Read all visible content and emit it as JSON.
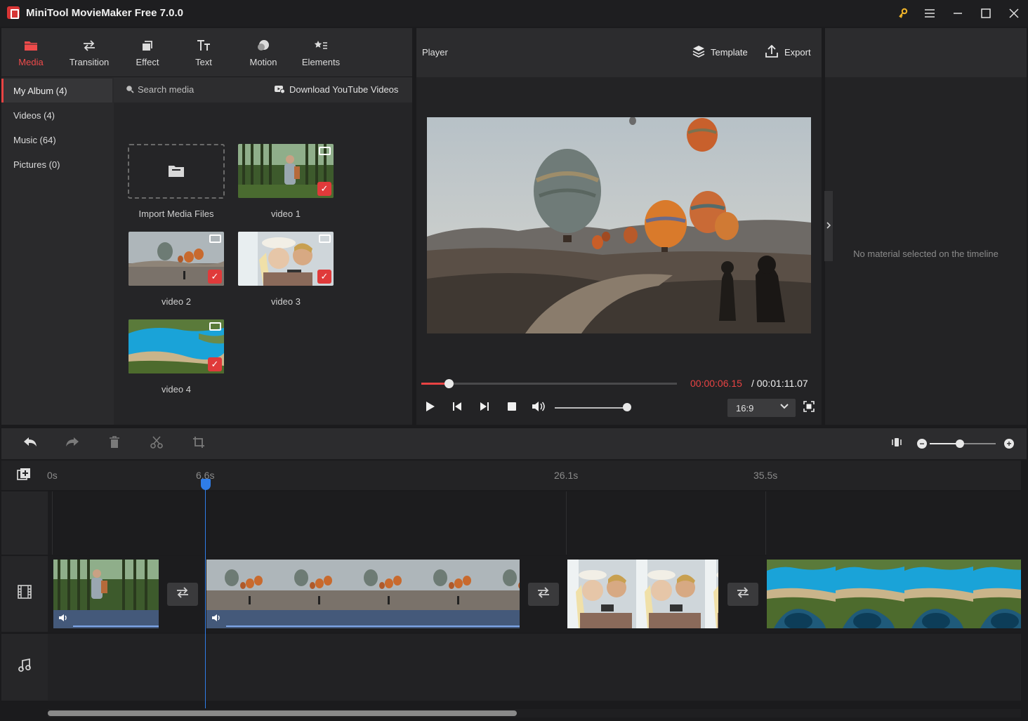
{
  "window": {
    "title": "MiniTool MovieMaker Free 7.0.0"
  },
  "tabs": [
    {
      "label": "Media",
      "icon": "folder-icon",
      "active": true
    },
    {
      "label": "Transition",
      "icon": "transition-icon"
    },
    {
      "label": "Effect",
      "icon": "effect-icon"
    },
    {
      "label": "Text",
      "icon": "text-icon"
    },
    {
      "label": "Motion",
      "icon": "motion-icon"
    },
    {
      "label": "Elements",
      "icon": "elements-icon"
    }
  ],
  "sidebar": {
    "items": [
      {
        "label": "My Album (4)",
        "active": true
      },
      {
        "label": "Videos (4)"
      },
      {
        "label": "Music (64)"
      },
      {
        "label": "Pictures (0)"
      }
    ]
  },
  "media": {
    "search_placeholder": "Search media",
    "download_label": "Download YouTube Videos",
    "import_label": "Import Media Files",
    "items": [
      {
        "label": "video 1"
      },
      {
        "label": "video 2"
      },
      {
        "label": "video 3"
      },
      {
        "label": "video 4"
      }
    ]
  },
  "player": {
    "title": "Player",
    "template_label": "Template",
    "export_label": "Export",
    "current_time": "00:00:06.15",
    "total_time": "/ 00:01:11.07",
    "progress": 0.086,
    "volume": 1.0,
    "aspect_ratio": "16:9"
  },
  "properties": {
    "empty_message": "No material selected on the timeline"
  },
  "timeline": {
    "ruler": [
      "0s",
      "6.6s",
      "26.1s",
      "35.5s"
    ],
    "zoom_level": 0.45
  },
  "colors": {
    "accent": "#e84343",
    "playhead": "#2f7de8"
  }
}
